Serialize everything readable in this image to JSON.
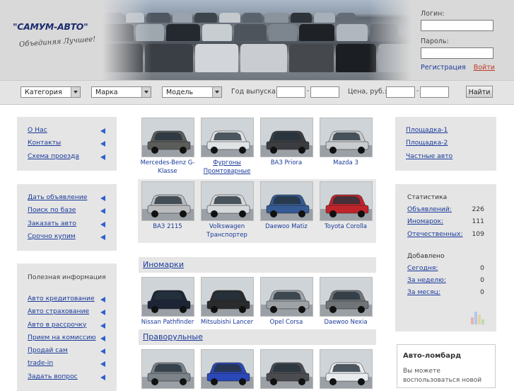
{
  "header": {
    "logo": "\"САМУМ-АВТО\"",
    "slogan": "Объединяя Лучшее!",
    "login_label": "Логин:",
    "password_label": "Пароль:",
    "register_link": "Регистрация",
    "enter_link": "Войти"
  },
  "search": {
    "category": "Категория",
    "make": "Марка",
    "model": "Модель",
    "year_label": "Год выпуска:",
    "price_label": "Цена, руб.:",
    "dash": "-",
    "find_button": "Найти"
  },
  "left_menu_1": [
    "О Нас",
    "Контакты",
    "Схема проезда"
  ],
  "left_menu_2": [
    "Дать объявление",
    "Поиск по базе",
    "Заказать авто",
    "Срочно купим"
  ],
  "left_menu_3": {
    "title": "Полезная информация",
    "items": [
      "Авто кредитование",
      "Авто страхование",
      "Авто в рассрочку",
      "Прием на комиссию",
      "Продай сам",
      "trade-in",
      "Задать вопрос"
    ]
  },
  "cars_row1": [
    {
      "caption": "Mercedes-Benz G-Klasse",
      "color": "#5a5d5a"
    },
    {
      "caption": "Фургоны Промтоварные",
      "color": "#dfe3e6"
    },
    {
      "caption": "ВАЗ Priora",
      "color": "#3b3d40"
    },
    {
      "caption": "Mazda 3",
      "color": "#c9ccce"
    }
  ],
  "cars_row2": [
    {
      "caption": "ВАЗ 2115",
      "color": "#b9bbbd"
    },
    {
      "caption": "Volkswagen Транспортер",
      "color": "#d5d8da"
    },
    {
      "caption": "Daewoo Matiz",
      "color": "#365a93"
    },
    {
      "caption": "Toyota Corolla",
      "color": "#c0242b"
    }
  ],
  "section_foreign": "Иномарки",
  "cars_row3": [
    {
      "caption": "Nissan Pathfinder",
      "color": "#1c2436"
    },
    {
      "caption": "Mitsubishi Lancer",
      "color": "#2a2b2d"
    },
    {
      "caption": "Opel Corsa",
      "color": "#9ea2a6"
    },
    {
      "caption": "Daewoo Nexia",
      "color": "#6f7478"
    }
  ],
  "section_rhd": "Праворульные",
  "cars_row4": [
    {
      "caption": "",
      "color": "#7b8288"
    },
    {
      "caption": "",
      "color": "#2a48b8"
    },
    {
      "caption": "",
      "color": "#4a4c50"
    },
    {
      "caption": "",
      "color": "#e9ecee"
    }
  ],
  "right_links": [
    "Площадка-1",
    "Площадка-2",
    "Частные авто"
  ],
  "stats": {
    "title": "Статистика",
    "rows": [
      {
        "label": "Объявлений:",
        "value": "226"
      },
      {
        "label": "Иномарок:",
        "value": "111"
      },
      {
        "label": "Отечественных:",
        "value": "109"
      }
    ],
    "added_title": "Добавлено",
    "added": [
      {
        "label": "Сегодня:",
        "value": "0"
      },
      {
        "label": "За неделю:",
        "value": "0"
      },
      {
        "label": "За месяц:",
        "value": "0"
      }
    ]
  },
  "pawn": {
    "title": "Авто-ломбард",
    "text": "Вы можете воспользоваться новой"
  },
  "colors": {
    "link": "#1a3a9a",
    "marker": "#2f5fd0",
    "logo": "#1c2c6e",
    "enter": "#c0392b"
  }
}
